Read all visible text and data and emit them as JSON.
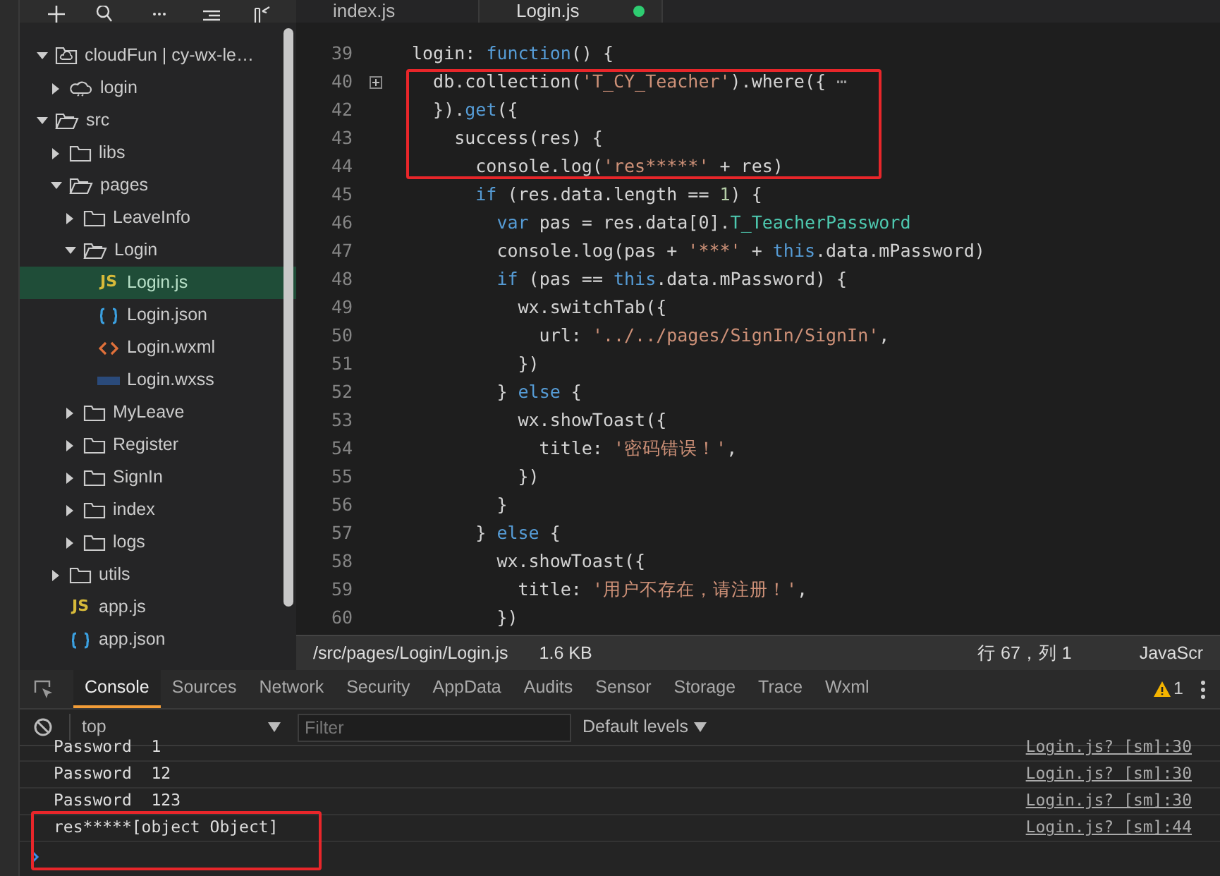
{
  "tree": [
    {
      "label": "cloudFun | cy-wx-le…",
      "kind": "cloud-root",
      "expanded": true,
      "selected": false,
      "children": [
        {
          "label": "login",
          "kind": "cloud",
          "expanded": false,
          "selected": false
        }
      ]
    },
    {
      "label": "src",
      "kind": "folder",
      "expanded": true,
      "selected": false,
      "children": [
        {
          "label": "libs",
          "kind": "folder",
          "expanded": false,
          "selected": false
        },
        {
          "label": "pages",
          "kind": "folder",
          "expanded": true,
          "selected": false,
          "children": [
            {
              "label": "LeaveInfo",
              "kind": "folder",
              "expanded": false,
              "selected": false
            },
            {
              "label": "Login",
              "kind": "folder",
              "expanded": true,
              "selected": false,
              "children": [
                {
                  "label": "Login.js",
                  "kind": "js",
                  "icon": "JS",
                  "selected": true
                },
                {
                  "label": "Login.json",
                  "kind": "json",
                  "selected": false
                },
                {
                  "label": "Login.wxml",
                  "kind": "wxml",
                  "selected": false
                },
                {
                  "label": "Login.wxss",
                  "kind": "wxss",
                  "selected": false
                }
              ]
            },
            {
              "label": "MyLeave",
              "kind": "folder",
              "expanded": false,
              "selected": false
            },
            {
              "label": "Register",
              "kind": "folder",
              "expanded": false,
              "selected": false
            },
            {
              "label": "SignIn",
              "kind": "folder",
              "expanded": false,
              "selected": false
            },
            {
              "label": "index",
              "kind": "folder",
              "expanded": false,
              "selected": false
            },
            {
              "label": "logs",
              "kind": "folder",
              "expanded": false,
              "selected": false
            }
          ]
        },
        {
          "label": "utils",
          "kind": "folder",
          "expanded": false,
          "selected": false
        },
        {
          "label": "app.js",
          "kind": "js",
          "icon": "JS",
          "selected": false
        },
        {
          "label": "app.json",
          "kind": "json",
          "selected": false
        }
      ]
    }
  ],
  "editor_tabs": [
    {
      "label": "index.js",
      "selected": false,
      "modified": false
    },
    {
      "label": "Login.js",
      "selected": true,
      "modified": true
    }
  ],
  "code": [
    {
      "num": "39",
      "folded": false,
      "highlighted": false,
      "tokens": [
        {
          "kind": "plain",
          "text": "login: "
        },
        {
          "kind": "keyword",
          "text": "function"
        },
        {
          "kind": "plain",
          "text": "() {"
        }
      ]
    },
    {
      "num": "40",
      "folded": true,
      "highlighted": true,
      "tokens": [
        {
          "kind": "plain",
          "text": "  db.collection("
        },
        {
          "kind": "string",
          "text": "'T_CY_Teacher'"
        },
        {
          "kind": "plain",
          "text": ").where({ "
        },
        {
          "kind": "ellipsis",
          "text": "⋯"
        }
      ]
    },
    {
      "num": "42",
      "folded": false,
      "highlighted": true,
      "tokens": [
        {
          "kind": "plain",
          "text": "  })."
        },
        {
          "kind": "keyword",
          "text": "get"
        },
        {
          "kind": "plain",
          "text": "({"
        }
      ]
    },
    {
      "num": "43",
      "folded": false,
      "highlighted": true,
      "tokens": [
        {
          "kind": "plain",
          "text": "    success(res) {"
        }
      ]
    },
    {
      "num": "44",
      "folded": false,
      "highlighted": true,
      "tokens": [
        {
          "kind": "plain",
          "text": "      console.log("
        },
        {
          "kind": "string",
          "text": "'res*****'"
        },
        {
          "kind": "plain",
          "text": " + res)"
        }
      ]
    },
    {
      "num": "45",
      "folded": false,
      "highlighted": false,
      "tokens": [
        {
          "kind": "keyword",
          "text": "      if"
        },
        {
          "kind": "plain",
          "text": " (res.data.length == "
        },
        {
          "kind": "number",
          "text": "1"
        },
        {
          "kind": "plain",
          "text": ") {"
        }
      ]
    },
    {
      "num": "46",
      "folded": false,
      "highlighted": false,
      "tokens": [
        {
          "kind": "keyword",
          "text": "        var"
        },
        {
          "kind": "plain",
          "text": " pas = res.data[0]."
        },
        {
          "kind": "property",
          "text": "T_TeacherPassword"
        }
      ]
    },
    {
      "num": "47",
      "folded": false,
      "highlighted": false,
      "tokens": [
        {
          "kind": "plain",
          "text": "        console.log(pas + "
        },
        {
          "kind": "string",
          "text": "'***'"
        },
        {
          "kind": "plain",
          "text": " + "
        },
        {
          "kind": "keyword",
          "text": "this"
        },
        {
          "kind": "plain",
          "text": ".data.mPassword)"
        }
      ]
    },
    {
      "num": "48",
      "folded": false,
      "highlighted": false,
      "tokens": [
        {
          "kind": "keyword",
          "text": "        if"
        },
        {
          "kind": "plain",
          "text": " (pas == "
        },
        {
          "kind": "keyword",
          "text": "this"
        },
        {
          "kind": "plain",
          "text": ".data.mPassword) {"
        }
      ]
    },
    {
      "num": "49",
      "folded": false,
      "highlighted": false,
      "tokens": [
        {
          "kind": "plain",
          "text": "          wx.switchTab({"
        }
      ]
    },
    {
      "num": "50",
      "folded": false,
      "highlighted": false,
      "tokens": [
        {
          "kind": "plain",
          "text": "            url: "
        },
        {
          "kind": "string",
          "text": "'../../pages/SignIn/SignIn'"
        },
        {
          "kind": "plain",
          "text": ","
        }
      ]
    },
    {
      "num": "51",
      "folded": false,
      "highlighted": false,
      "tokens": [
        {
          "kind": "plain",
          "text": "          })"
        }
      ]
    },
    {
      "num": "52",
      "folded": false,
      "highlighted": false,
      "tokens": [
        {
          "kind": "plain",
          "text": "        } "
        },
        {
          "kind": "keyword",
          "text": "else"
        },
        {
          "kind": "plain",
          "text": " {"
        }
      ]
    },
    {
      "num": "53",
      "folded": false,
      "highlighted": false,
      "tokens": [
        {
          "kind": "plain",
          "text": "          wx.showToast({"
        }
      ]
    },
    {
      "num": "54",
      "folded": false,
      "highlighted": false,
      "tokens": [
        {
          "kind": "plain",
          "text": "            title: "
        },
        {
          "kind": "string",
          "text": "'密码错误！'"
        },
        {
          "kind": "plain",
          "text": ","
        }
      ]
    },
    {
      "num": "55",
      "folded": false,
      "highlighted": false,
      "tokens": [
        {
          "kind": "plain",
          "text": "          })"
        }
      ]
    },
    {
      "num": "56",
      "folded": false,
      "highlighted": false,
      "tokens": [
        {
          "kind": "plain",
          "text": "        }"
        }
      ]
    },
    {
      "num": "57",
      "folded": false,
      "highlighted": false,
      "tokens": [
        {
          "kind": "plain",
          "text": "      } "
        },
        {
          "kind": "keyword",
          "text": "else"
        },
        {
          "kind": "plain",
          "text": " {"
        }
      ]
    },
    {
      "num": "58",
      "folded": false,
      "highlighted": false,
      "tokens": [
        {
          "kind": "plain",
          "text": "        wx.showToast({"
        }
      ]
    },
    {
      "num": "59",
      "folded": false,
      "highlighted": false,
      "tokens": [
        {
          "kind": "plain",
          "text": "          title: "
        },
        {
          "kind": "string",
          "text": "'用户不存在，请注册！'"
        },
        {
          "kind": "plain",
          "text": ","
        }
      ]
    },
    {
      "num": "60",
      "folded": false,
      "highlighted": false,
      "tokens": [
        {
          "kind": "plain",
          "text": "        })"
        }
      ]
    }
  ],
  "status_bar": {
    "path": "/src/pages/Login/Login.js",
    "size": "1.6 KB",
    "position": "行 67，列 1",
    "language": "JavaScr"
  },
  "devtools": {
    "tabs": [
      {
        "label": "Console",
        "selected": true
      },
      {
        "label": "Sources",
        "selected": false
      },
      {
        "label": "Network",
        "selected": false
      },
      {
        "label": "Security",
        "selected": false
      },
      {
        "label": "AppData",
        "selected": false
      },
      {
        "label": "Audits",
        "selected": false
      },
      {
        "label": "Sensor",
        "selected": false
      },
      {
        "label": "Storage",
        "selected": false
      },
      {
        "label": "Trace",
        "selected": false
      },
      {
        "label": "Wxml",
        "selected": false
      }
    ],
    "warning_count": "1",
    "context": "top",
    "filter_placeholder": "Filter",
    "levels": "Default levels",
    "messages": [
      {
        "text": "Password  1",
        "source": "Login.js? [sm]:30",
        "highlighted": false
      },
      {
        "text": "Password  12",
        "source": "Login.js? [sm]:30",
        "highlighted": false
      },
      {
        "text": "Password  123",
        "source": "Login.js? [sm]:30",
        "highlighted": false
      },
      {
        "text": "res*****[object Object]",
        "source": "Login.js? [sm]:44",
        "highlighted": true
      }
    ]
  }
}
